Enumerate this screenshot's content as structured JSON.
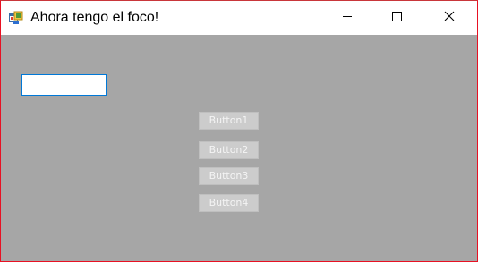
{
  "window": {
    "title": "Ahora tengo el foco!",
    "app_icon": "winforms-app-icon",
    "controls": {
      "minimize_icon": "minimize-icon",
      "maximize_icon": "maximize-icon",
      "close_icon": "close-icon"
    }
  },
  "form": {
    "textbox": {
      "value": ""
    },
    "buttons": [
      {
        "label": "Button1"
      },
      {
        "label": "Button2"
      },
      {
        "label": "Button3"
      },
      {
        "label": "Button4"
      }
    ]
  },
  "colors": {
    "client_background": "#a6a6a6",
    "textbox_focus_border": "#0078d7",
    "disabled_button_text": "#f4f4f4"
  }
}
